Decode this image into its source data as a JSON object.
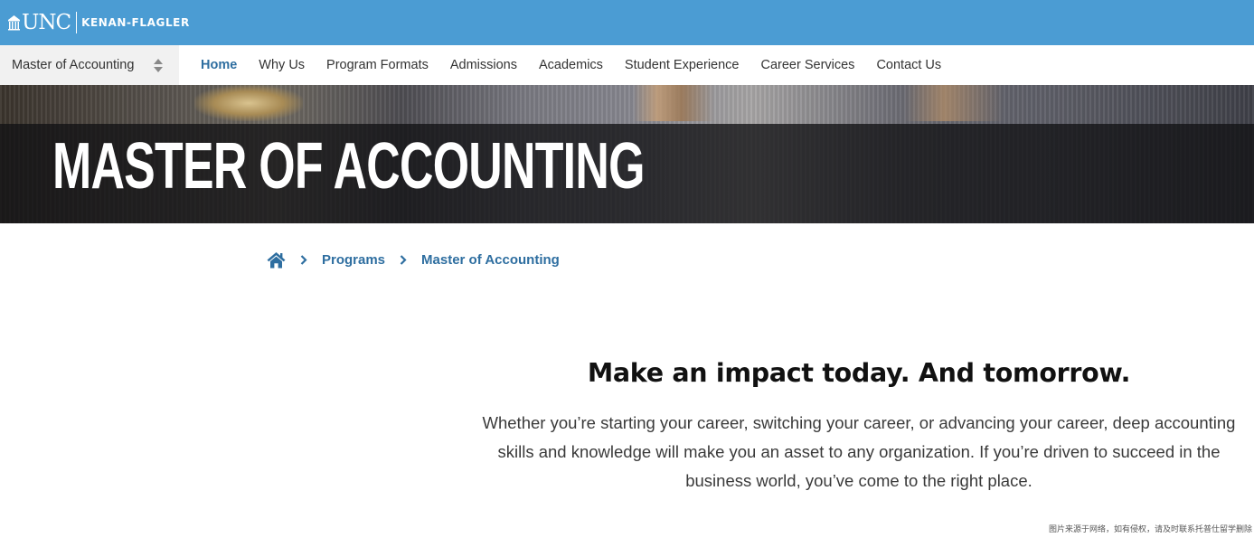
{
  "brand": {
    "logo_unc": "UNC",
    "logo_school": "KENAN-FLAGLER",
    "bar_color": "#4b9cd3"
  },
  "nav": {
    "program_select": "Master of Accounting",
    "links": [
      "Home",
      "Why Us",
      "Program Formats",
      "Admissions",
      "Academics",
      "Student Experience",
      "Career Services",
      "Contact Us"
    ],
    "active": "Home",
    "accent_color": "#2e6ea0"
  },
  "hero": {
    "title": "MASTER OF ACCOUNTING"
  },
  "breadcrumb": {
    "home_icon": "home-icon",
    "items": [
      "Programs",
      "Master of Accounting"
    ]
  },
  "intro": {
    "heading": "Make an impact today. And tomorrow.",
    "body": "Whether you’re starting your career, switching your career, or advancing your career, deep accounting skills and knowledge will make you an asset to any organization. If you’re driven to succeed in the business world, you’ve come to the right place."
  },
  "watermark": "图片来源于网络，如有侵权，请及时联系托普仕留学删除"
}
